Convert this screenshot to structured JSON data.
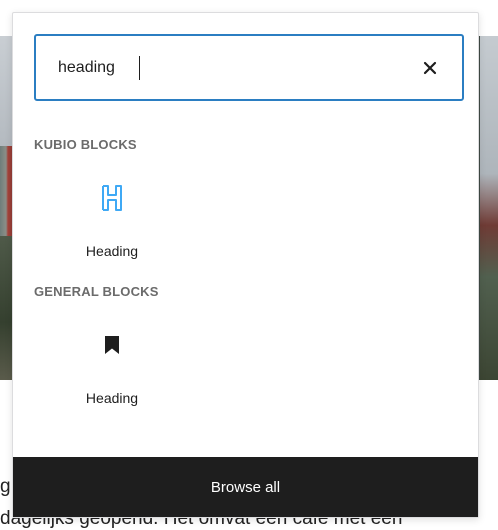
{
  "background": {
    "text_line1": "g                                                                                                 s",
    "text_line2": "dagelijks geopend. Het omvat een café met een"
  },
  "search": {
    "value": "heading",
    "clear_icon": "close-icon"
  },
  "sections": {
    "kubio": {
      "title": "KUBIO BLOCKS",
      "item_label": "Heading",
      "item_icon": "heading-h-icon",
      "icon_color": "#3fa9f5"
    },
    "general": {
      "title": "GENERAL BLOCKS",
      "item_label": "Heading",
      "item_icon": "bookmark-icon",
      "icon_color": "#1e1e1e"
    }
  },
  "footer": {
    "browse_all_label": "Browse all"
  },
  "colors": {
    "focus_border": "#2b7ec2",
    "footer_bg": "#1e1e1e"
  }
}
